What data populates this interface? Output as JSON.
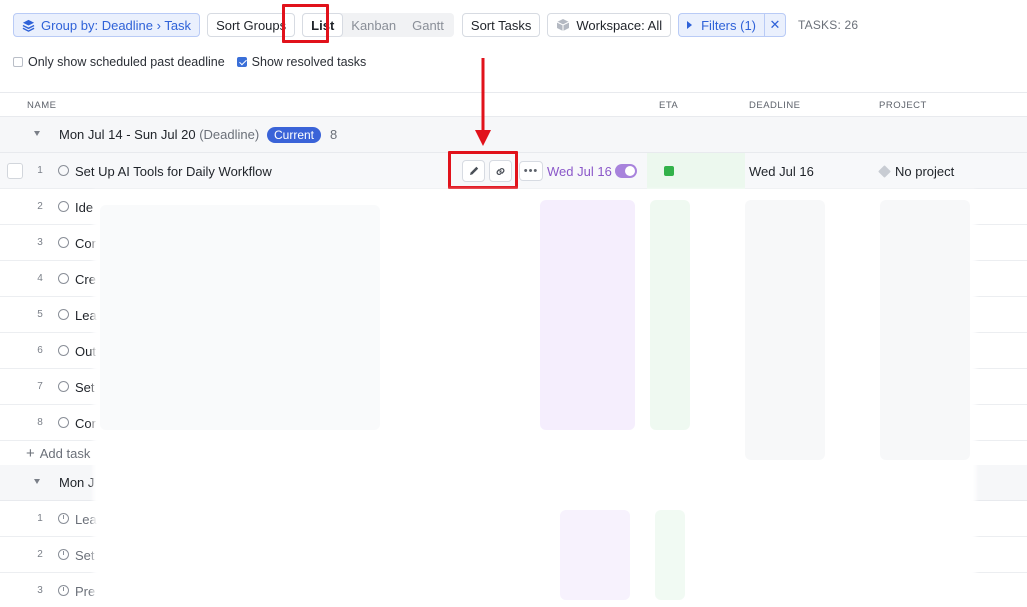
{
  "toolbar": {
    "group_by": "Group by: Deadline › Task",
    "sort_groups": "Sort Groups",
    "views": [
      "List",
      "Kanban",
      "Gantt"
    ],
    "sort_tasks": "Sort Tasks",
    "workspace": "Workspace: All",
    "filters": "Filters (1)",
    "filters_clear": "✕",
    "task_count": "TASKS: 26"
  },
  "options": {
    "past_deadline": "Only show scheduled past deadline",
    "show_resolved": "Show resolved tasks"
  },
  "columns": {
    "name": "NAME",
    "eta": "ETA",
    "deadline": "DEADLINE",
    "project": "PROJECT"
  },
  "groups": [
    {
      "title": "Mon Jul 14 - Sun Jul 20",
      "subtitle": "(Deadline)",
      "badge": "Current",
      "count": "8",
      "rows": [
        {
          "num": "1",
          "name": "Set Up AI Tools for Daily Workflow",
          "date": "Wed Jul 16",
          "deadline": "Wed Jul 16",
          "project": "No project"
        },
        {
          "num": "2",
          "name": "Ide"
        },
        {
          "num": "3",
          "name": "Cor"
        },
        {
          "num": "4",
          "name": "Cre"
        },
        {
          "num": "5",
          "name": "Lea"
        },
        {
          "num": "6",
          "name": "Out"
        },
        {
          "num": "7",
          "name": "Set"
        },
        {
          "num": "8",
          "name": "Cor"
        }
      ],
      "add_task": "Add task"
    },
    {
      "title": "Mon J",
      "rows": [
        {
          "num": "1",
          "name": "Lea"
        },
        {
          "num": "2",
          "name": "Set"
        },
        {
          "num": "3",
          "name": "Pre"
        }
      ]
    }
  ],
  "colors": {
    "accent": "#3a63d8",
    "highlight": "#e1121b",
    "date_purple": "#8b58c9",
    "eta_green": "#33b24a"
  }
}
